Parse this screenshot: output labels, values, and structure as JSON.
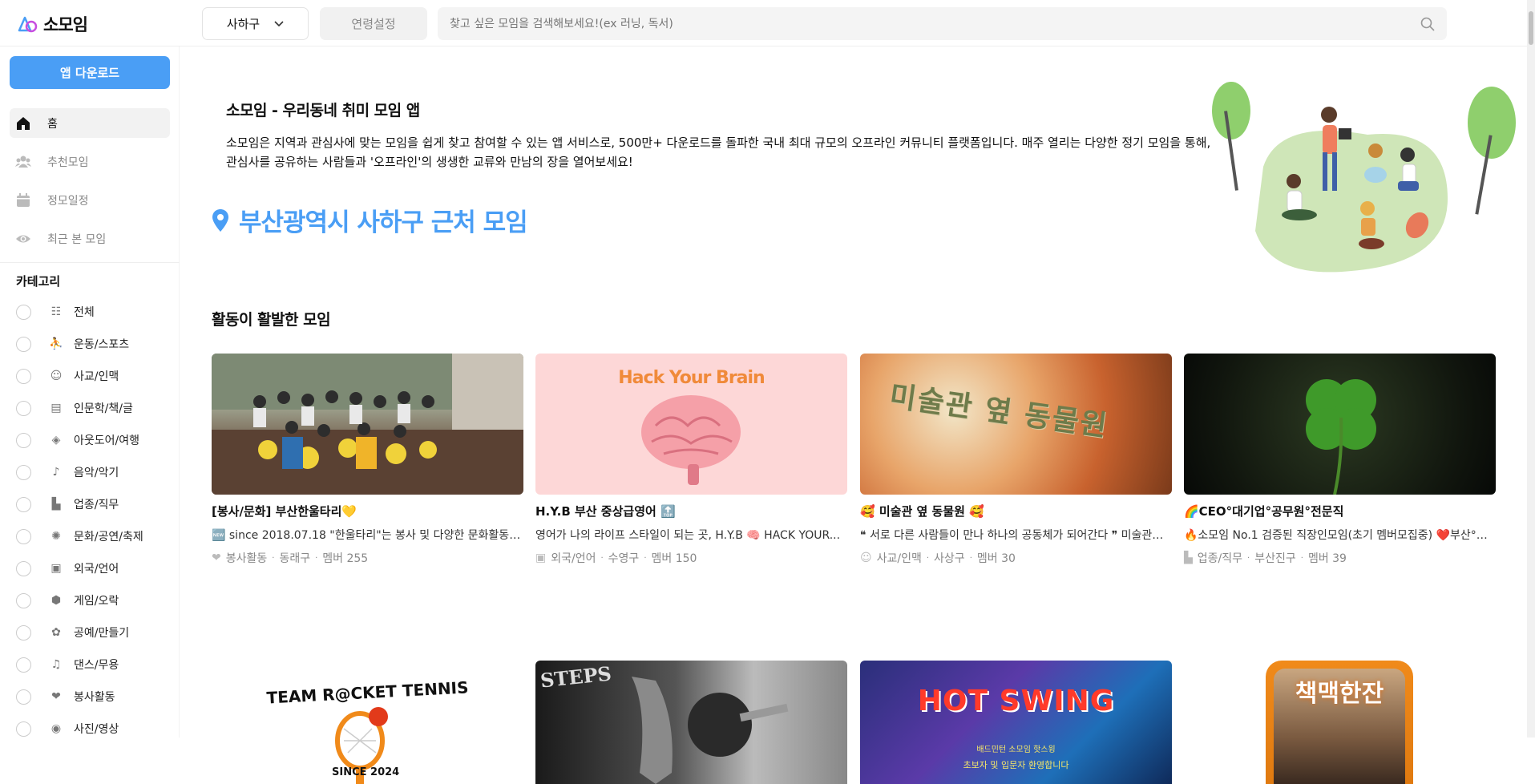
{
  "header": {
    "logo_text": "소모임",
    "region": "사하구",
    "age_button": "연령설정",
    "search_placeholder": "찾고 싶은 모임을 검색해보세요!(ex 러닝, 독서)"
  },
  "sidebar": {
    "download_label": "앱 다운로드",
    "nav": [
      {
        "label": "홈",
        "icon": "home-icon"
      },
      {
        "label": "추천모임",
        "icon": "group-icon"
      },
      {
        "label": "정모일정",
        "icon": "calendar-icon"
      },
      {
        "label": "최근 본 모임",
        "icon": "eye-icon"
      }
    ],
    "category_title": "카테고리",
    "categories": [
      {
        "label": "전체"
      },
      {
        "label": "운동/스포츠"
      },
      {
        "label": "사교/인맥"
      },
      {
        "label": "인문학/책/글"
      },
      {
        "label": "아웃도어/여행"
      },
      {
        "label": "음악/악기"
      },
      {
        "label": "업종/직무"
      },
      {
        "label": "문화/공연/축제"
      },
      {
        "label": "외국/언어"
      },
      {
        "label": "게임/오락"
      },
      {
        "label": "공예/만들기"
      },
      {
        "label": "댄스/무용"
      },
      {
        "label": "봉사활동"
      },
      {
        "label": "사진/영상"
      }
    ]
  },
  "hero": {
    "title": "소모임 - 우리동네 취미 모임 앱",
    "description": "소모임은 지역과 관심사에 맞는 모임을 쉽게 찾고 참여할 수 있는 앱 서비스로, 500만+ 다운로드를 돌파한 국내 최대 규모의 오프라인 커뮤니티 플랫폼입니다. 매주 열리는 다양한 정기 모임을 통해, 관심사를 공유하는 사람들과 '오프라인'의 생생한 교류와 만남의 장을 열어보세요!",
    "location_heading": "부산광역시 사하구 근처 모임"
  },
  "section": {
    "title": "활동이 활발한 모임"
  },
  "cards": [
    {
      "title": "[봉사/문화] 부산한울타리💛",
      "desc": "🆕 since 2018.07.18 \"한울타리\"는 봉사 및 다양한 문화활동을 ...",
      "category": "봉사활동",
      "area": "동래구",
      "members": "멤버 255"
    },
    {
      "title": "H.Y.B 부산 중상급영어 🔝",
      "desc": "영어가 나의 라이프 스타일이 되는 곳, H.Y.B 🧠 HACK YOUR...",
      "category": "외국/언어",
      "area": "수영구",
      "members": "멤버 150",
      "image_text": "Hack Your Brain"
    },
    {
      "title": "🥰 미술관 옆 동물원 🥰",
      "desc": "❝ 서로 다른 사람들이 만나 하나의 공동체가 되어간다 ❞ 미술관이...",
      "category": "사교/인맥",
      "area": "사상구",
      "members": "멤버 30",
      "image_text": "미술관 옆 동물원"
    },
    {
      "title": "🌈CEO°대기업°공무원°전문직",
      "desc": "🔥소모임 No.1 검증된 직장인모임(초기 멤버모집중) ❤️부산°울...",
      "category": "업종/직무",
      "area": "부산진구",
      "members": "멤버 39"
    }
  ],
  "row2": [
    {
      "image_text": "TEAM R@CKET TENNIS",
      "sub": "SINCE 2024"
    },
    {
      "image_text": "STEPS"
    },
    {
      "image_text": "HOT SWING",
      "sub": "배드민턴 소모임 핫스윙",
      "sub2": "초보자 및 입문자 환영합니다"
    },
    {
      "image_text": "책맥한잔"
    }
  ]
}
